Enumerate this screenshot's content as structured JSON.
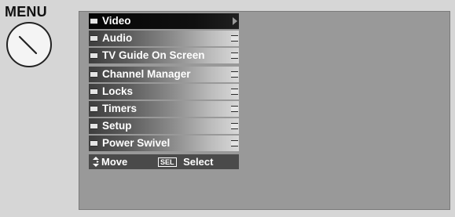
{
  "menu_title": "MENU",
  "menu_items": [
    {
      "label": "Video",
      "selected": true
    },
    {
      "label": "Audio",
      "selected": false
    },
    {
      "label": "TV Guide On Screen",
      "selected": false
    },
    {
      "label": "Channel Manager",
      "selected": false
    },
    {
      "label": "Locks",
      "selected": false
    },
    {
      "label": "Timers",
      "selected": false
    },
    {
      "label": "Setup",
      "selected": false
    },
    {
      "label": "Power Swivel",
      "selected": false
    }
  ],
  "help": {
    "move_label": "Move",
    "sel_key": "SEL",
    "select_label": "Select"
  },
  "icons": {
    "dial": "menu-dial-icon",
    "updown": "up-down-arrow-icon",
    "submenu": "right-arrow-icon"
  },
  "colors": {
    "screen_bg": "#999999",
    "selected_item": "#101010",
    "help_bar": "#4a4a4a"
  }
}
